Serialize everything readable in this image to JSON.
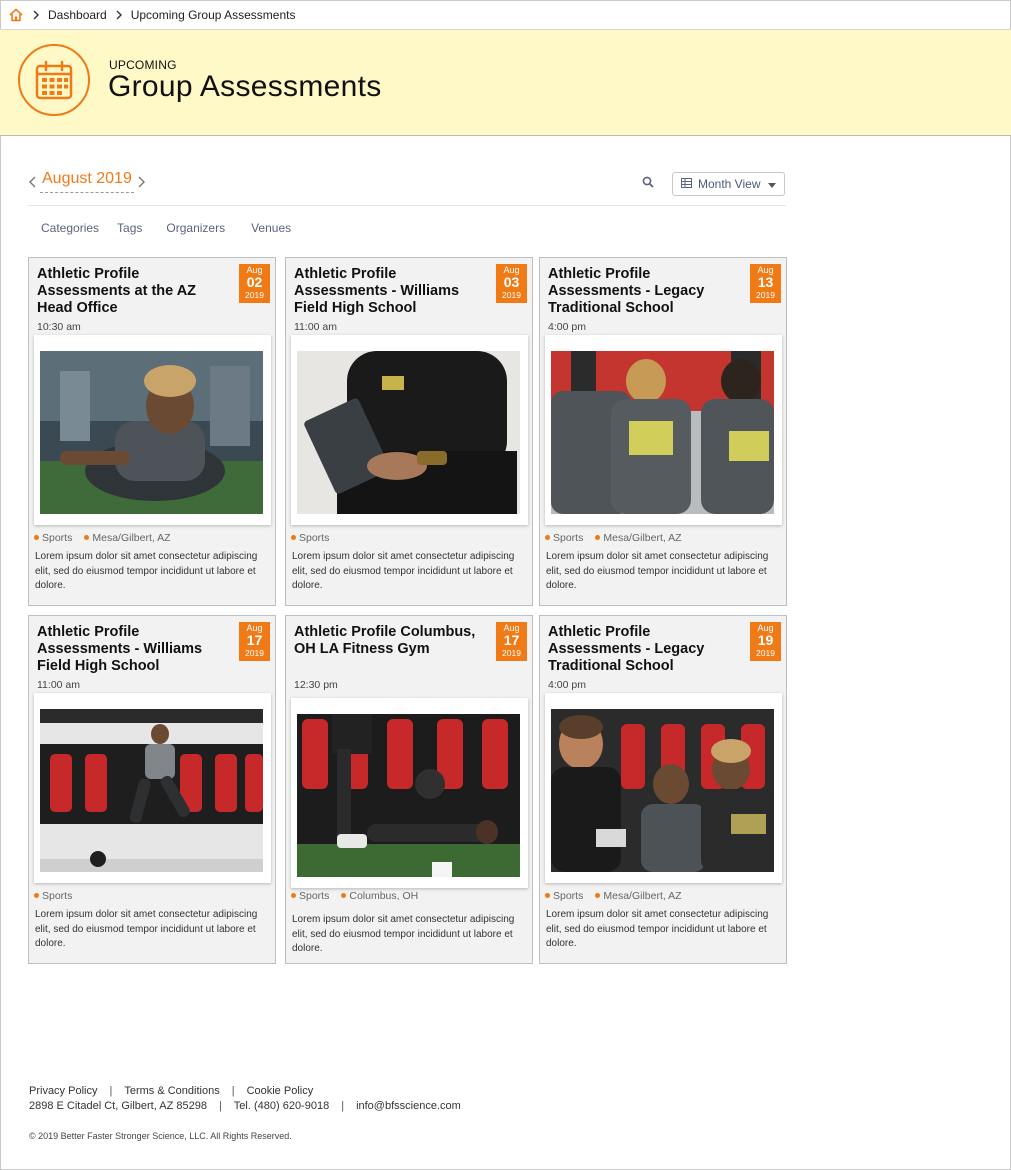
{
  "breadcrumb": {
    "items": [
      "Dashboard",
      "Upcoming Group Assessments"
    ]
  },
  "header": {
    "kicker": "UPCOMING",
    "title": "Group Assessments",
    "icon": "calendar-icon"
  },
  "toolbar": {
    "month": "August 2019",
    "view_label": "Month View"
  },
  "filters": [
    "Categories",
    "Tags",
    "Organizers",
    "Venues"
  ],
  "events": [
    {
      "title": "Athletic Profile Assessments at the AZ Head Office",
      "month": "Aug",
      "day": "02",
      "year": "2019",
      "time": "10:30 am",
      "tags": [
        "Sports",
        "Mesa/Gilbert, AZ"
      ],
      "description": "Lorem ipsum dolor sit amet consectetur adipiscing elit, sed do eiusmod tempor incididunt ut labore et dolore."
    },
    {
      "title": "Athletic Profile Assessments - Williams Field High School",
      "month": "Aug",
      "day": "03",
      "year": "2019",
      "time": "11:00 am",
      "tags": [
        "Sports"
      ],
      "description": "Lorem ipsum dolor sit amet consectetur adipiscing elit, sed do eiusmod tempor incididunt ut labore et dolore."
    },
    {
      "title": "Athletic Profile Assessments - Legacy Traditional School",
      "month": "Aug",
      "day": "13",
      "year": "2019",
      "time": "4:00 pm",
      "tags": [
        "Sports",
        "Mesa/Gilbert, AZ"
      ],
      "description": "Lorem ipsum dolor sit amet consectetur adipiscing elit, sed do eiusmod tempor incididunt ut labore et dolore."
    },
    {
      "title": "Athletic Profile Assessments - Williams Field High School",
      "month": "Aug",
      "day": "17",
      "year": "2019",
      "time": "11:00 am",
      "tags": [
        "Sports"
      ],
      "description": "Lorem ipsum dolor sit amet consectetur adipiscing elit, sed do eiusmod tempor incididunt ut labore et dolore."
    },
    {
      "title": "Athletic Profile Columbus, OH LA Fitness Gym",
      "month": "Aug",
      "day": "17",
      "year": "2019",
      "time": "12:30 pm",
      "tags": [
        "Sports",
        "Columbus, OH"
      ],
      "description": "Lorem ipsum dolor sit amet consectetur adipiscing elit, sed do eiusmod tempor incididunt ut labore et dolore."
    },
    {
      "title": "Athletic Profile Assessments - Legacy Traditional School",
      "month": "Aug",
      "day": "19",
      "year": "2019",
      "time": "4:00 pm",
      "tags": [
        "Sports",
        "Mesa/Gilbert, AZ"
      ],
      "description": "Lorem ipsum dolor sit amet consectetur adipiscing elit, sed do eiusmod tempor incididunt ut labore et dolore."
    }
  ],
  "footer": {
    "links": [
      "Privacy Policy",
      "Terms & Conditions",
      "Cookie Policy"
    ],
    "address": "2898 E Citadel Ct, Gilbert, AZ 85298",
    "phone": "Tel.  (480) 620-9018",
    "email": "info@bfsscience.com",
    "copyright": "© 2019 Better Faster Stronger Science, LLC.   All Rights Reserved."
  },
  "colors": {
    "accent": "#f07a16",
    "header_bg": "#fff9c8",
    "card_bg": "#f1f2f1"
  }
}
